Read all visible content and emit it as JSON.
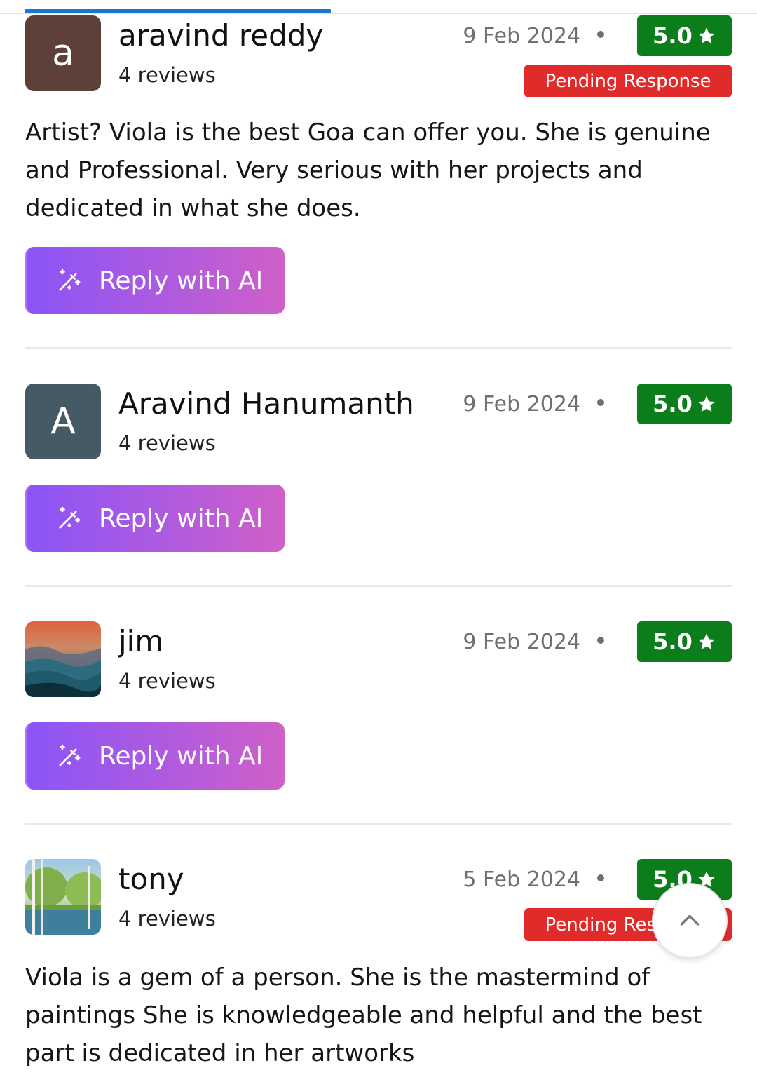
{
  "reviews": [
    {
      "initial": "a",
      "name": "aravind reddy",
      "count": "4 reviews",
      "date": "9 Feb 2024",
      "rating": "5.0",
      "status": "Pending Response",
      "text": "Artist? Viola is the best Goa can offer you. She is genuine and Professional. Very serious with her projects and dedicated in what she does.",
      "avatar_color": "#5d4037"
    },
    {
      "initial": "A",
      "name": "Aravind Hanumanth",
      "count": "4 reviews",
      "date": "9 Feb 2024",
      "rating": "5.0",
      "avatar_color": "#455a64"
    },
    {
      "name": "jim",
      "count": "4 reviews",
      "date": "9 Feb 2024",
      "rating": "5.0"
    },
    {
      "name": "tony",
      "count": "4 reviews",
      "date": "5 Feb 2024",
      "rating": "5.0",
      "status": "Pending Response",
      "text": "Viola is a gem of a person. She is the mastermind of paintings She is knowledgeable and helpful and the best part is dedicated in her artworks"
    }
  ],
  "reply_button_label": "Reply with AI",
  "icons": {
    "star": "star-icon",
    "magic_wand": "magic-wand-icon",
    "scroll_top": "chevron-up-icon"
  },
  "colors": {
    "rating_bg": "#0b7d1a",
    "pending_bg": "#e12b2b",
    "progress": "#1976d2",
    "button_gradient_start": "#8b55f7",
    "button_gradient_end": "#d060c8"
  }
}
